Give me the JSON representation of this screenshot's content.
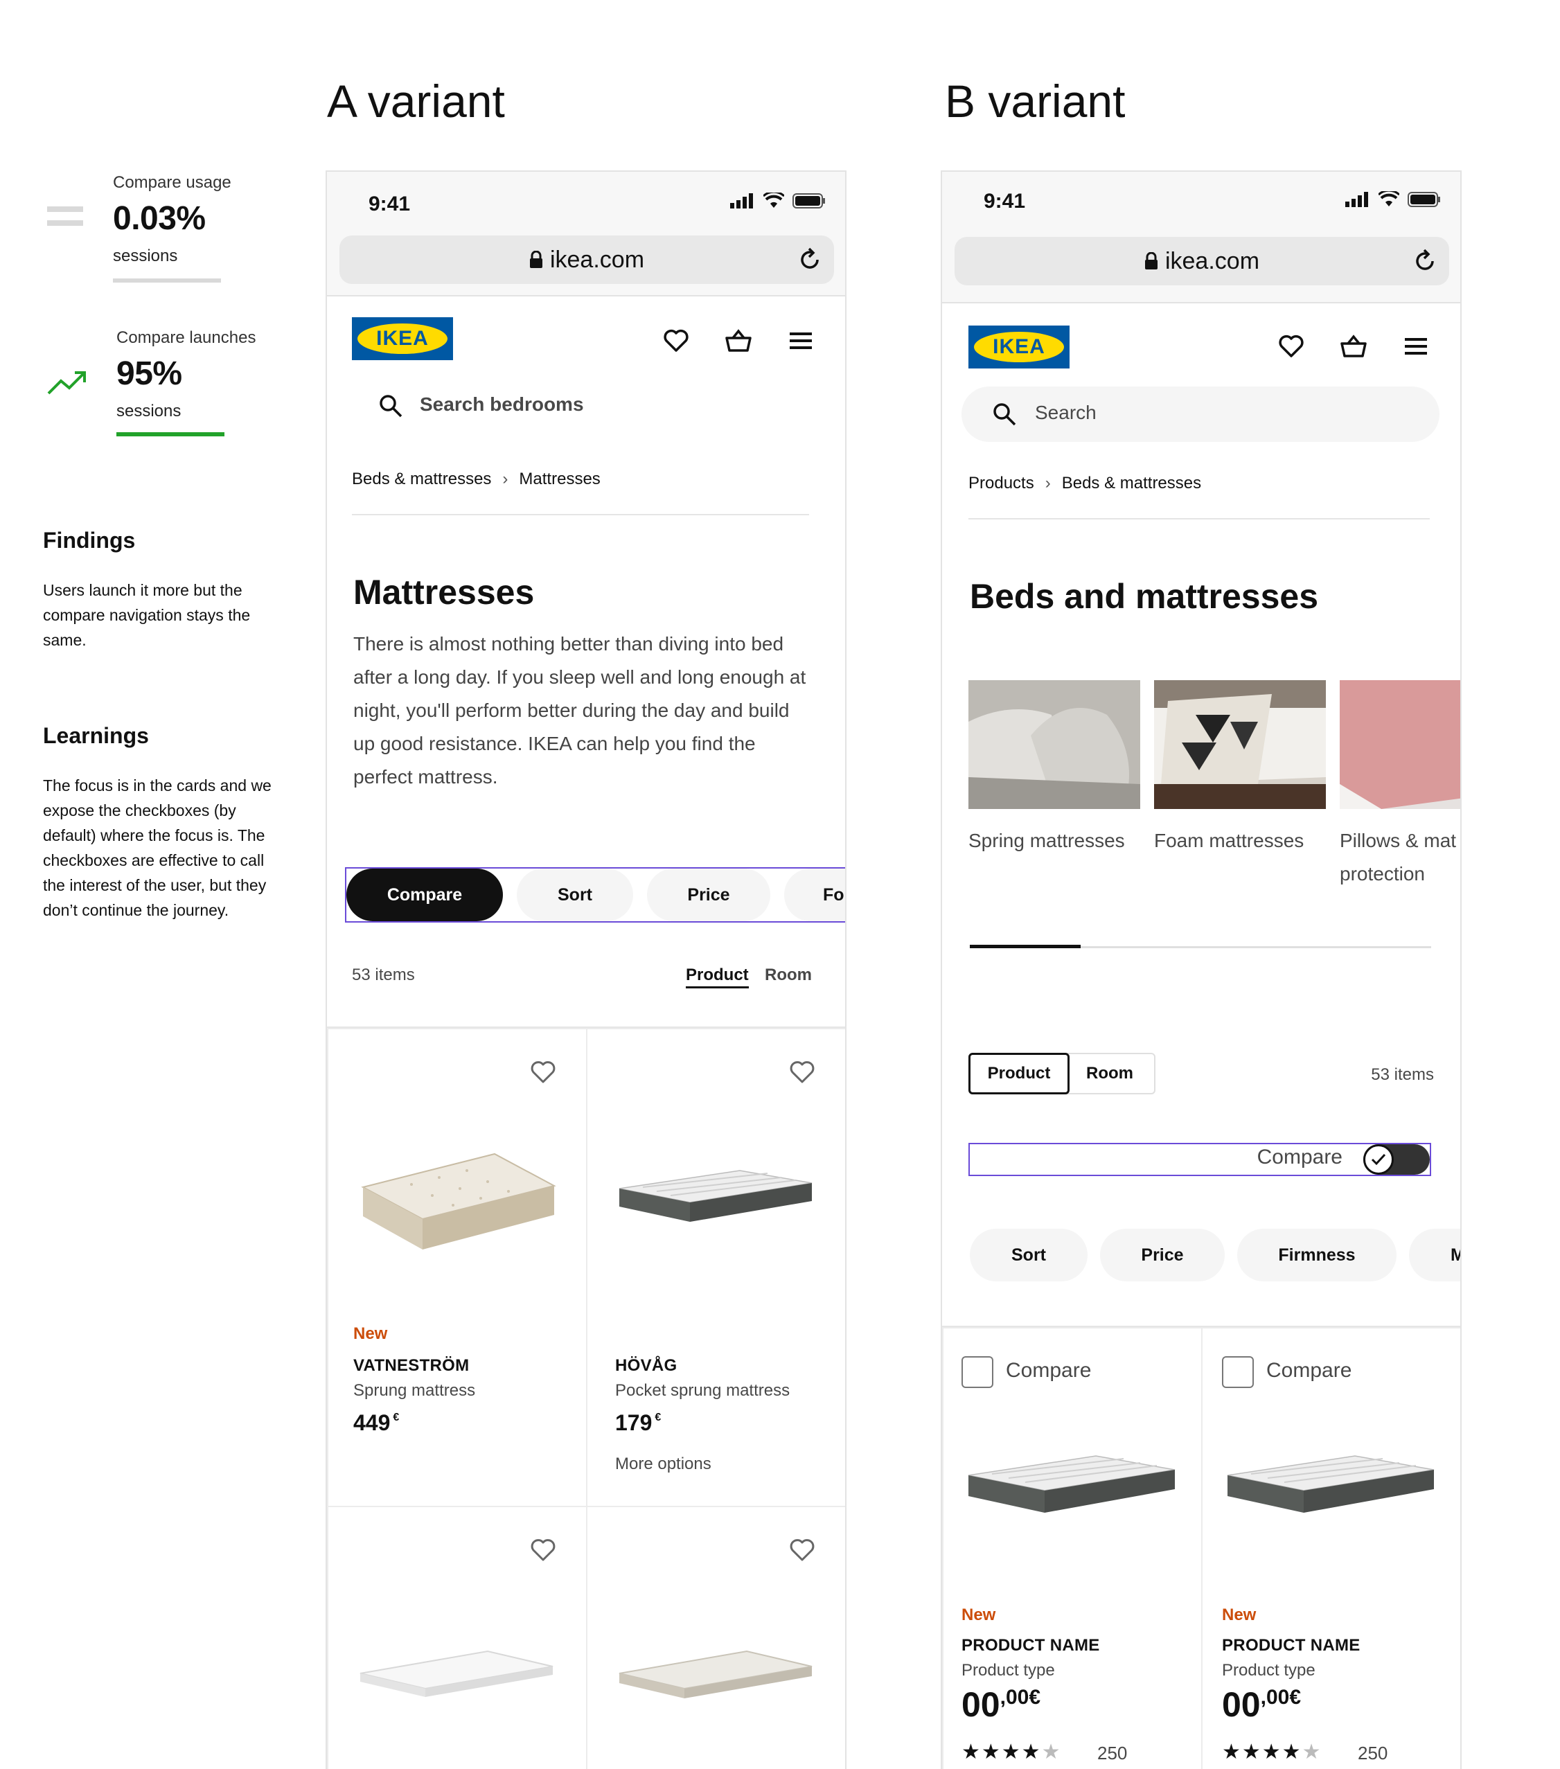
{
  "metrics": [
    {
      "label": "Compare usage",
      "value": "0.03%",
      "unit": "sessions",
      "trend": "equal-icon",
      "bar_color": "#d9d9d9"
    },
    {
      "label": "Compare launches",
      "value": "95%",
      "unit": "sessions",
      "trend": "trending-up-icon",
      "bar_color": "#22a22a"
    }
  ],
  "findings": {
    "title": "Findings",
    "text": "Users launch it more but the compare navigation stays the same."
  },
  "learnings": {
    "title": "Learnings",
    "text": "The focus is in the cards and we expose the checkboxes (by default) where the focus is. The checkboxes are effective to call the interest of the user, but they don’t continue the journey."
  },
  "variant_a": {
    "title": "A variant",
    "time": "9:41",
    "url": "ikea.com",
    "logo": "IKEA",
    "search_label": "Search bedrooms",
    "breadcrumb": [
      "Beds & mattresses",
      "Mattresses"
    ],
    "heading": "Mattresses",
    "intro": "There is almost nothing better than diving into bed after a long day. If you sleep well and long enough at night, you'll perform better during the day and build up good resistance. IKEA can help you find the perfect mattress.",
    "filters": [
      "Compare",
      "Sort",
      "Price",
      "Fo"
    ],
    "item_count": "53 items",
    "view_tabs": [
      "Product",
      "Room"
    ],
    "products": [
      {
        "badge": "New",
        "name": "VATNESTRÖM",
        "type": "Sprung mattress",
        "price": "449",
        "currency": "€",
        "more": ""
      },
      {
        "badge": "",
        "name": "HÖVÅG",
        "type": "Pocket sprung mattress",
        "price": "179",
        "currency": "€",
        "more": "More options"
      }
    ]
  },
  "variant_b": {
    "title": "B variant",
    "time": "9:41",
    "url": "ikea.com",
    "logo": "IKEA",
    "search_placeholder": "Search",
    "breadcrumb": [
      "Products",
      "Beds & mattresses"
    ],
    "heading": "Beds and mattresses",
    "categories": [
      "Spring mattresses",
      "Foam mattresses",
      "Pillows & mat protection"
    ],
    "category_lines": [
      [
        "Spring mattresses"
      ],
      [
        "Foam mattresses"
      ],
      [
        "Pillows & mat",
        "protection"
      ]
    ],
    "carousel_progress": 0.24,
    "view_tabs": [
      "Product",
      "Room"
    ],
    "item_count": "53 items",
    "compare_toggle_label": "Compare",
    "filters": [
      "Sort",
      "Price",
      "Firmness",
      "M"
    ],
    "products": [
      {
        "compare_label": "Compare",
        "badge": "New",
        "name": "PRODUCT NAME",
        "type": "Product type",
        "price_int": "00",
        "price_dec": ",00",
        "currency": "€",
        "stars": 4.5,
        "reviews": "250"
      },
      {
        "compare_label": "Compare",
        "badge": "New",
        "name": "PRODUCT NAME",
        "type": "Product type",
        "price_int": "00",
        "price_dec": ",00",
        "currency": "€",
        "stars": 4.5,
        "reviews": "250"
      }
    ]
  }
}
